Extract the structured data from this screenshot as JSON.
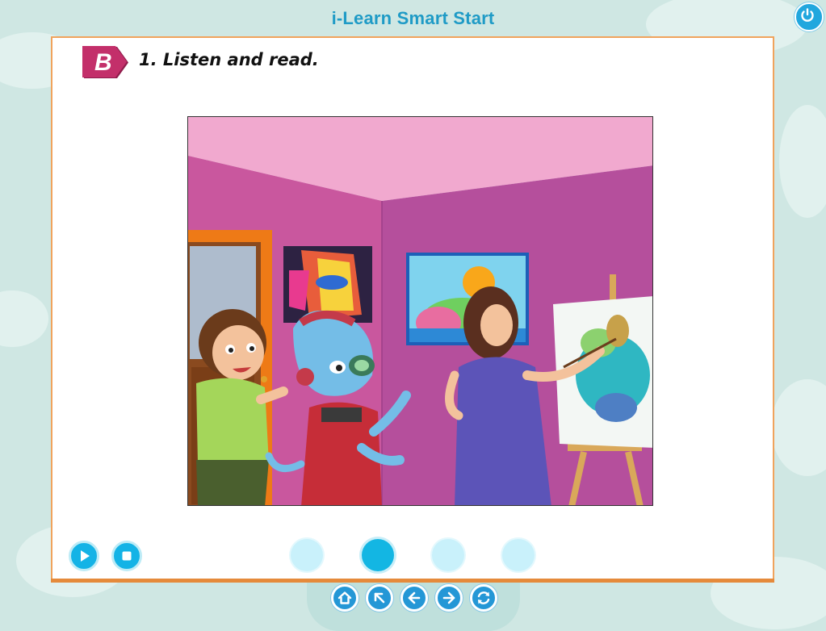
{
  "app": {
    "title": "i-Learn Smart Start"
  },
  "toolbar": {
    "power_icon": "power-icon"
  },
  "lesson": {
    "section_letter": "B",
    "instruction": "1. Listen and read."
  },
  "audio_controls": {
    "play_icon": "play-icon",
    "stop_icon": "stop-icon"
  },
  "pages": {
    "count": 4,
    "active_index": 2
  },
  "navigation": {
    "buttons": [
      "home-icon",
      "arrow-up-left-icon",
      "arrow-left-icon",
      "arrow-right-icon",
      "refresh-icon"
    ]
  },
  "colors": {
    "accent": "#14b3e6",
    "panel_border": "#f0a35c",
    "title": "#1f9bc6",
    "badge": "#c32f6a"
  }
}
